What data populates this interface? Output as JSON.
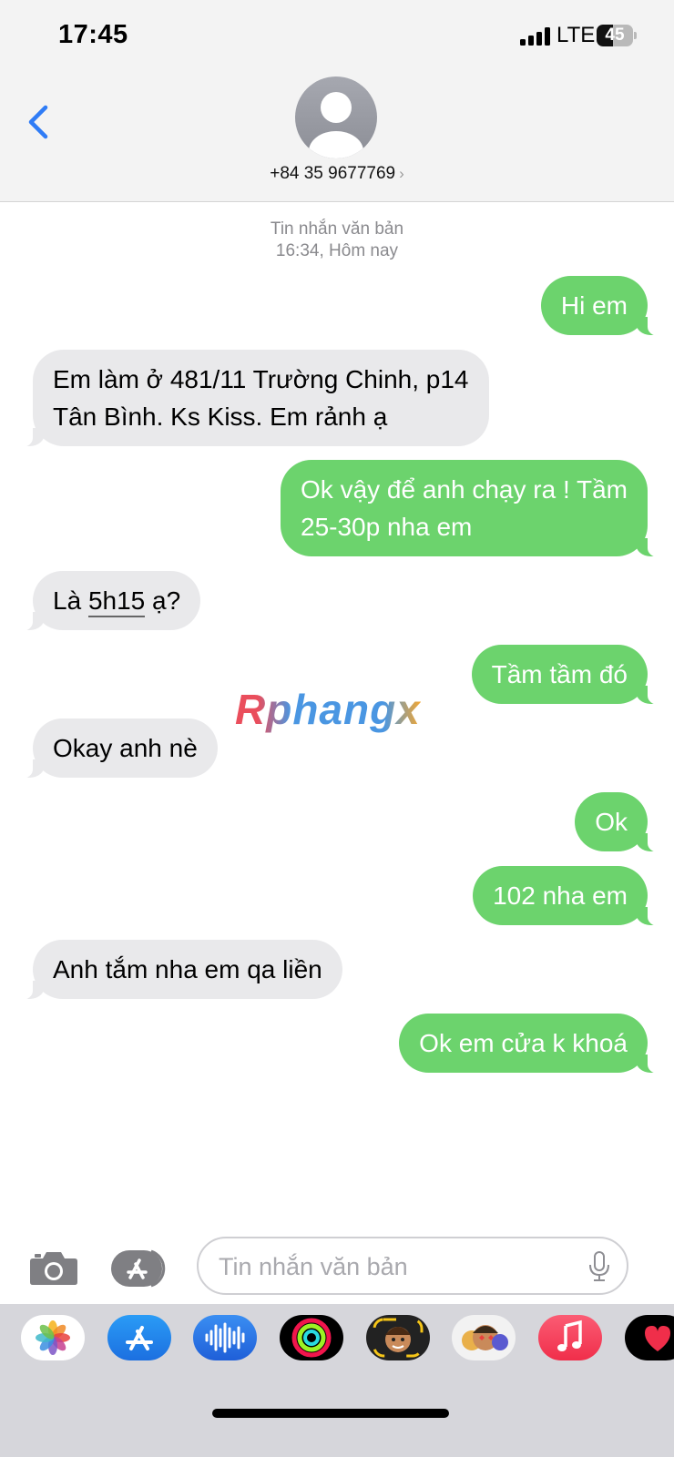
{
  "status_bar": {
    "time": "17:45",
    "carrier": "LTE",
    "battery_level": 45,
    "battery_text": "45"
  },
  "header": {
    "contact": "+84 35 9677769",
    "chevron": "›"
  },
  "conversation": {
    "meta_line1": "Tin nhắn văn bản",
    "meta_line2": "16:34, Hôm nay",
    "messages": [
      {
        "direction": "sent",
        "text": "Hi em"
      },
      {
        "direction": "received",
        "line1": "Em làm ở 481/11 Trường Chinh, p14",
        "line2": "Tân Bình. Ks Kiss. Em rảnh ạ"
      },
      {
        "direction": "sent",
        "line1": "Ok vậy để anh chạy ra ! Tầm",
        "line2": "25-30p nha em"
      },
      {
        "direction": "received",
        "prefix": "Là ",
        "link": "5h15",
        "suffix": " ạ?"
      },
      {
        "direction": "sent",
        "text": "Tầm tầm đó"
      },
      {
        "direction": "received",
        "text": "Okay anh nè"
      },
      {
        "direction": "sent",
        "text": "Ok"
      },
      {
        "direction": "sent",
        "text": "102 nha em"
      },
      {
        "direction": "received",
        "text": "Anh tắm nha em qa liền"
      },
      {
        "direction": "sent",
        "text": "Ok em cửa k khoá"
      }
    ]
  },
  "watermark": "Rphangx",
  "input": {
    "placeholder": "Tin nhắn văn bản"
  },
  "app_drawer": [
    "photos-icon",
    "app-store-icon",
    "audio-message-icon",
    "activity-icon",
    "memoji-icon",
    "animoji-stickers-icon",
    "music-icon",
    "digital-touch-icon"
  ],
  "colors": {
    "sent_bubble": "#6cd36d",
    "received_bubble": "#e9e9eb",
    "accent_blue": "#2f7cf6"
  }
}
